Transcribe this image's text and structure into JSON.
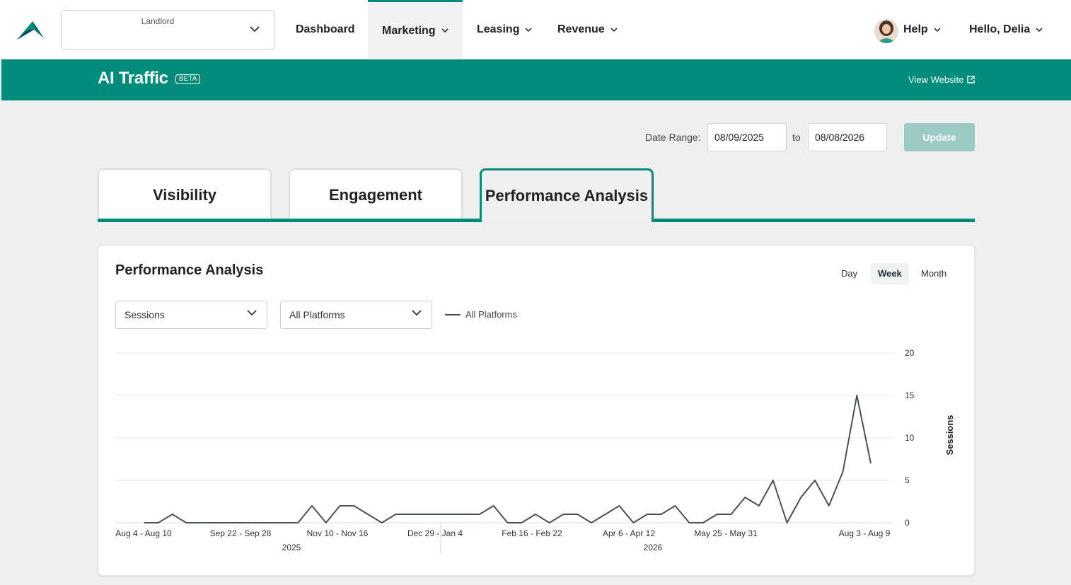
{
  "nav": {
    "property_label": "Landlord",
    "items": [
      {
        "label": "Dashboard"
      },
      {
        "label": "Marketing"
      },
      {
        "label": "Leasing"
      },
      {
        "label": "Revenue"
      }
    ],
    "help_label": "Help",
    "user_label": "Hello, Delia",
    "active_item": "Marketing"
  },
  "header": {
    "title": "AI Traffic",
    "badge": "BETA",
    "view_website": "View Website"
  },
  "date_range": {
    "label": "Date Range:",
    "start": "08/09/2025",
    "to": "to",
    "end": "08/08/2026",
    "update_label": "Update"
  },
  "tabs": [
    {
      "label": "Visibility"
    },
    {
      "label": "Engagement"
    },
    {
      "label": "Performance Analysis"
    }
  ],
  "active_tab": "Performance Analysis",
  "card": {
    "title": "Performance Analysis",
    "granularity": [
      "Day",
      "Week",
      "Month"
    ],
    "active_granularity": "Week",
    "metric_select": "Sessions",
    "platform_select": "All Platforms",
    "legend_label": "All Platforms"
  },
  "colors": {
    "brand": "#008c7a",
    "line": "#4a5058",
    "update_disabled": "#9ccac4"
  },
  "chart_data": {
    "type": "line",
    "ylabel": "Sessions",
    "ylim": [
      0,
      20
    ],
    "yticks": [
      0,
      5,
      10,
      15,
      20
    ],
    "y_axis_side": "right",
    "grid": true,
    "x_labels": [
      "Aug 4 - Aug 10",
      "Sep 22 - Sep 28",
      "Nov 10 - Nov 16",
      "Dec 29 - Jan 4",
      "Feb 16 - Feb 22",
      "Apr 6 - Apr 12",
      "May 25 - May 31",
      "Aug 3 - Aug 9"
    ],
    "year_labels": [
      "2025",
      "2026"
    ],
    "series": [
      {
        "name": "All Platforms",
        "values": [
          0,
          0,
          1,
          0,
          0,
          0,
          0,
          0,
          0,
          0,
          0,
          0,
          2,
          0,
          2,
          2,
          1,
          0,
          1,
          1,
          1,
          1,
          1,
          1,
          1,
          2,
          0,
          0,
          1,
          0,
          1,
          1,
          0,
          1,
          2,
          0,
          1,
          1,
          2,
          0,
          0,
          1,
          1,
          3,
          2,
          5,
          0,
          3,
          5,
          2,
          6,
          15,
          7
        ]
      }
    ]
  }
}
